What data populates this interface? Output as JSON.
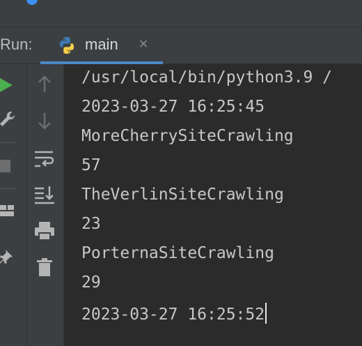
{
  "runbar": {
    "label": "Run:",
    "tab": {
      "label": "main",
      "icon": "python-icon",
      "close_icon": "close-icon"
    }
  },
  "console": {
    "lines": [
      "/usr/local/bin/python3.9 /",
      "2023-03-27 16:25:45",
      "MoreCherrySiteCrawling",
      "57",
      "TheVerlinSiteCrawling",
      "23",
      "PorternaSiteCrawling",
      "29",
      "2023-03-27 16:25:52"
    ]
  },
  "left_toolbar": {
    "icons": [
      "run-icon",
      "wrench-icon",
      "stop-icon",
      "layout-icon",
      "pin-icon"
    ]
  },
  "console_toolbar": {
    "icons": [
      "up-arrow-icon",
      "down-arrow-icon",
      "soft-wrap-icon",
      "scroll-to-end-icon",
      "print-icon",
      "trash-icon"
    ]
  },
  "colors": {
    "panel": "#3c3f41",
    "console_bg": "#2b2b2b",
    "text": "#c7c7c7",
    "accent": "#4a88c7",
    "run_green": "#4caf50"
  }
}
